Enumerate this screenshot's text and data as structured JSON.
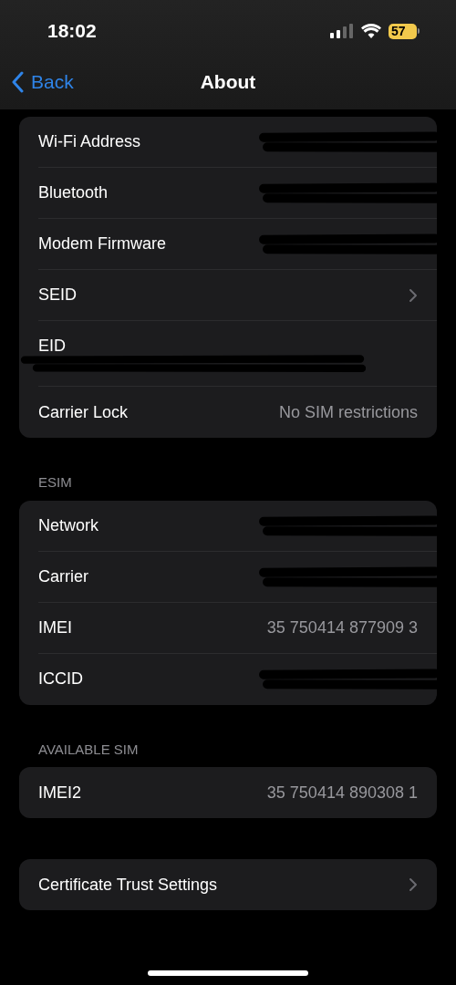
{
  "status_bar": {
    "time": "18:02",
    "battery": "57"
  },
  "nav": {
    "back": "Back",
    "title": "About"
  },
  "sections": [
    {
      "rows": [
        {
          "label": "Wi-Fi Address",
          "kind": "redacted"
        },
        {
          "label": "Bluetooth",
          "kind": "redacted"
        },
        {
          "label": "Modem Firmware",
          "kind": "redacted"
        },
        {
          "label": "SEID",
          "kind": "link"
        },
        {
          "label": "EID",
          "kind": "redacted_below"
        },
        {
          "label": "Carrier Lock",
          "kind": "text",
          "value": "No SIM restrictions"
        }
      ]
    },
    {
      "header": "ESIM",
      "rows": [
        {
          "label": "Network",
          "kind": "redacted"
        },
        {
          "label": "Carrier",
          "kind": "redacted"
        },
        {
          "label": "IMEI",
          "kind": "text",
          "value": "35 750414 877909 3"
        },
        {
          "label": "ICCID",
          "kind": "redacted"
        }
      ]
    },
    {
      "header": "AVAILABLE SIM",
      "rows": [
        {
          "label": "IMEI2",
          "kind": "text",
          "value": "35 750414 890308 1"
        }
      ]
    },
    {
      "rows": [
        {
          "label": "Certificate Trust Settings",
          "kind": "link"
        }
      ]
    }
  ]
}
